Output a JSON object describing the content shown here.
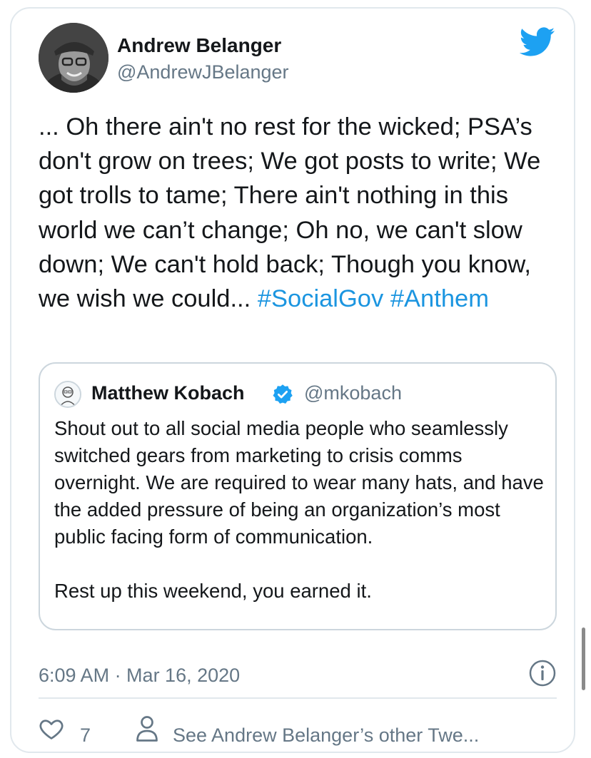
{
  "author": {
    "name": "Andrew Belanger",
    "handle": "@AndrewJBelanger"
  },
  "tweet": {
    "text": "... Oh there ain't no rest for the wicked; PSA’s don't grow on trees; We got posts to write; We got trolls to tame; There ain't nothing in this world we can’t change; Oh no, we can't slow down; We can't hold back; Though you know, we wish we could...",
    "hashtags": [
      "#SocialGov",
      "#Anthem"
    ]
  },
  "quoted": {
    "name": "Matthew Kobach",
    "handle": "@mkobach",
    "verified": true,
    "paragraph1": "Shout out to all social media people who seamlessly switched gears from marketing to crisis comms overnight. We are required to wear many hats, and have the added pressure of being an organization’s most public facing form of communication.",
    "paragraph2": "Rest up this weekend, you earned it."
  },
  "meta": {
    "timestamp": "6:09 AM · Mar 16, 2020"
  },
  "actions": {
    "likes": "7",
    "other_tweets": "See Andrew Belanger’s other Twe..."
  },
  "colors": {
    "link": "#1b95e0",
    "twitter_blue": "#1da1f2",
    "secondary_text": "#657786",
    "border": "#e1e8ed"
  },
  "icons": [
    "twitter-bird-icon",
    "verified-badge-icon",
    "info-icon",
    "heart-icon",
    "person-icon"
  ]
}
